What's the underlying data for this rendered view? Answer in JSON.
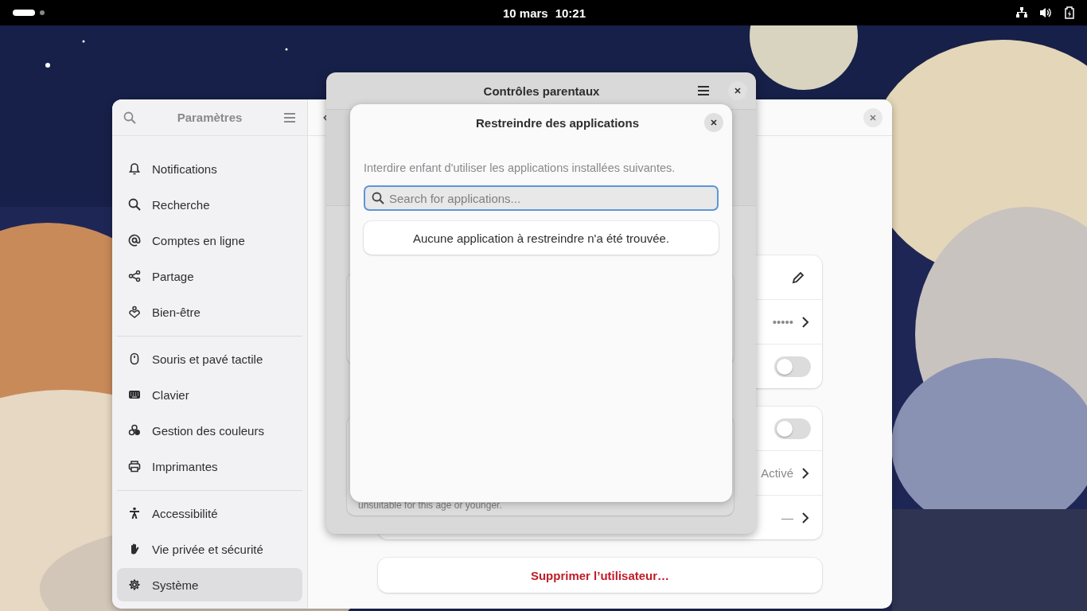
{
  "top_bar": {
    "date": "10 mars",
    "time": "10:21"
  },
  "settings": {
    "sidebar": {
      "title": "Paramètres",
      "groups": [
        {
          "items": [
            {
              "label": "Notifications",
              "selected": false
            },
            {
              "label": "Recherche",
              "selected": false
            },
            {
              "label": "Comptes en ligne",
              "selected": false
            },
            {
              "label": "Partage",
              "selected": false
            },
            {
              "label": "Bien-être",
              "selected": false
            }
          ]
        },
        {
          "items": [
            {
              "label": "Souris et pavé tactile",
              "selected": false
            },
            {
              "label": "Clavier",
              "selected": false
            },
            {
              "label": "Gestion des couleurs",
              "selected": false
            },
            {
              "label": "Imprimantes",
              "selected": false
            }
          ]
        },
        {
          "items": [
            {
              "label": "Accessibilité",
              "selected": false
            },
            {
              "label": "Vie privée et sécurité",
              "selected": false
            },
            {
              "label": "Système",
              "selected": true
            }
          ]
        }
      ]
    },
    "cards": [
      {
        "rows": [
          {
            "kind": "edit"
          },
          {
            "kind": "link",
            "value": "•••••"
          },
          {
            "kind": "switch",
            "on": false
          }
        ]
      },
      {
        "rows": [
          {
            "kind": "switch",
            "on": false
          },
          {
            "kind": "link",
            "value": "Activé"
          },
          {
            "kind": "link",
            "value": "—"
          }
        ]
      }
    ],
    "delete_button": "Supprimer l’utilisateur…"
  },
  "parental_controls": {
    "title": "Contrôles parentaux",
    "caption": "unsuitable for this age or younger."
  },
  "restrict_apps": {
    "title": "Restreindre des applications",
    "description": "Interdire enfant d'utiliser les applications installées suivantes.",
    "search": {
      "placeholder": "Search for applications..."
    },
    "empty_message": "Aucune application à restreindre n'a été trouvée."
  }
}
